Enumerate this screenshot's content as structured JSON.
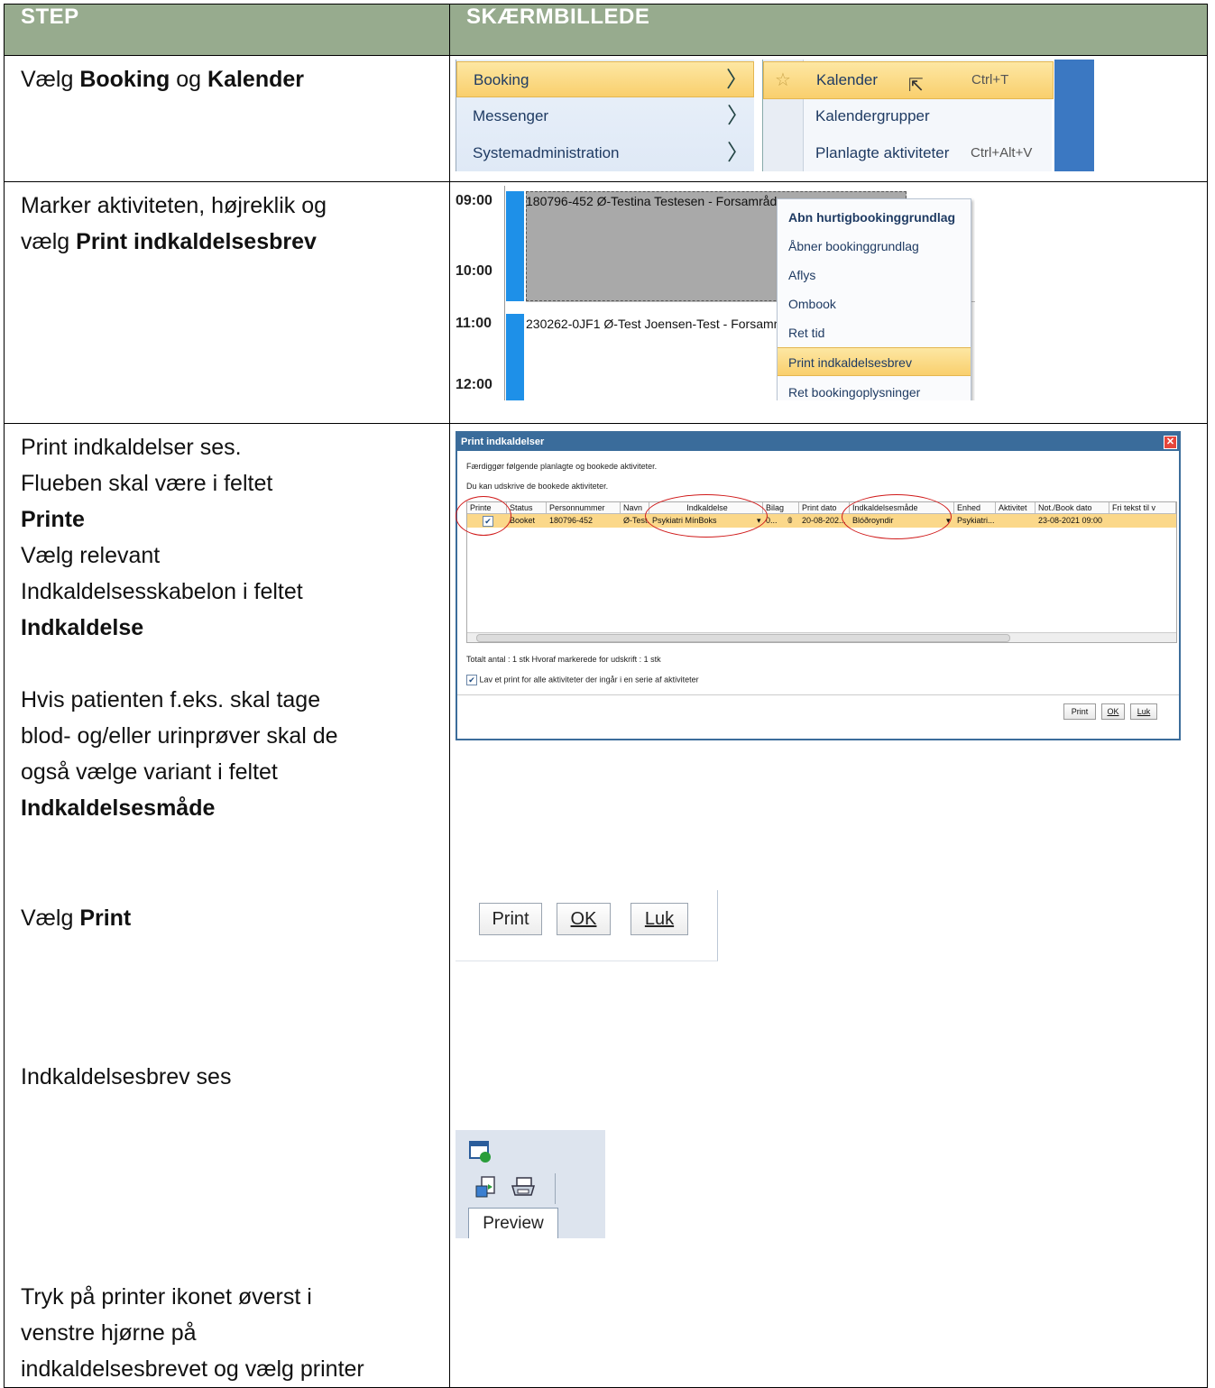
{
  "header": {
    "step": "STEP",
    "screenshot": "SKÆRMBILLEDE"
  },
  "rows": [
    {
      "step": {
        "t1": "Vælg ",
        "b1": "Booking",
        "t2": " og ",
        "b2": "Kalender"
      }
    },
    {
      "step": {
        "t1": "Marker aktiviteten, højreklik og",
        "t2": "vælg ",
        "b1": "Print indkaldelsesbrev"
      }
    },
    {
      "step": {
        "l1": "Print indkaldelser ses.",
        "l2": "Flueben skal være i feltet",
        "b1": "Printe",
        "l3": "Vælg relevant",
        "l4": "Indkaldelsesskabelon i feltet",
        "b2": "Indkaldelse",
        "l5": "Hvis patienten f.eks. skal tage",
        "l6": "blod- og/eller urinprøver skal de",
        "l7": "også vælge variant i feltet",
        "b3": "Indkaldelsesmåde",
        "l8": "Vælg ",
        "b4": "Print",
        "l9": "Indkaldelsesbrev ses",
        "l10": "Tryk på printer ikonet øverst i",
        "l11": "venstre hjørne på",
        "l12": "indkaldelsesbrevet og vælg printer"
      }
    }
  ],
  "menu": {
    "items": [
      "Booking",
      "Messenger",
      "Systemadministration"
    ],
    "submenu": [
      {
        "label": "Kalender",
        "shortcut": "Ctrl+T"
      },
      {
        "label": "Kalendergrupper",
        "shortcut": ""
      },
      {
        "label": "Planlagte aktiviteter",
        "shortcut": "Ctrl+Alt+V"
      }
    ]
  },
  "calendar": {
    "times": [
      "09:00",
      "10:00",
      "11:00",
      "12:00"
    ],
    "appt1": "180796-452  Ø-Testina Testesen - Forsamråde",
    "appt2": "230262-0JF1  Ø-Test Joensen-Test - Forsamråde",
    "context_menu": [
      "Abn hurtigbookinggrundlag",
      "Åbner bookinggrundlag",
      "Aflys",
      "Ombook",
      "Ret tid",
      "Print indkaldelsesbrev",
      "Ret bookingoplysninger"
    ]
  },
  "dialog": {
    "title": "Print indkaldelser",
    "close": "✕",
    "line1": "Færdiggør følgende planlagte og bookede aktiviteter.",
    "line2": "Du kan udskrive de bookede aktiviteter.",
    "columns": [
      "Printe",
      "Status",
      "Personnummer",
      "Navn",
      "Indkaldelse",
      "Bilag",
      "Print dato",
      "Indkaldelsesmåde",
      "Enhed",
      "Aktivitet",
      "Not./Book dato",
      "Fri tekst til v"
    ],
    "row": {
      "status": "Booket",
      "cpr": "180796-452",
      "name": "Ø-Test...",
      "indkaldelse": "Psykiatri MínBoks",
      "bilag": "0...",
      "print_dato": "20-08-202...",
      "maade": "Blóðroyndir",
      "enhed": "Psykiatri...",
      "book_dato": "23-08-2021 09:00"
    },
    "totals": "Totalt antal : 1 stk    Hvoraf markerede for udskrift : 1 stk",
    "series_check": "Lav et print for alle aktiviteter der ingår i en serie af aktiviteter",
    "buttons": [
      "Print",
      "OK",
      "Luk"
    ]
  },
  "big_buttons": [
    "Print",
    "OK",
    "Luk"
  ],
  "preview": {
    "tab": "Preview"
  },
  "colors": {
    "header_bg": "#97ab8e",
    "highlight": "#f9cf6d",
    "circle": "#d01a1a",
    "blue": "#1e90e8"
  }
}
